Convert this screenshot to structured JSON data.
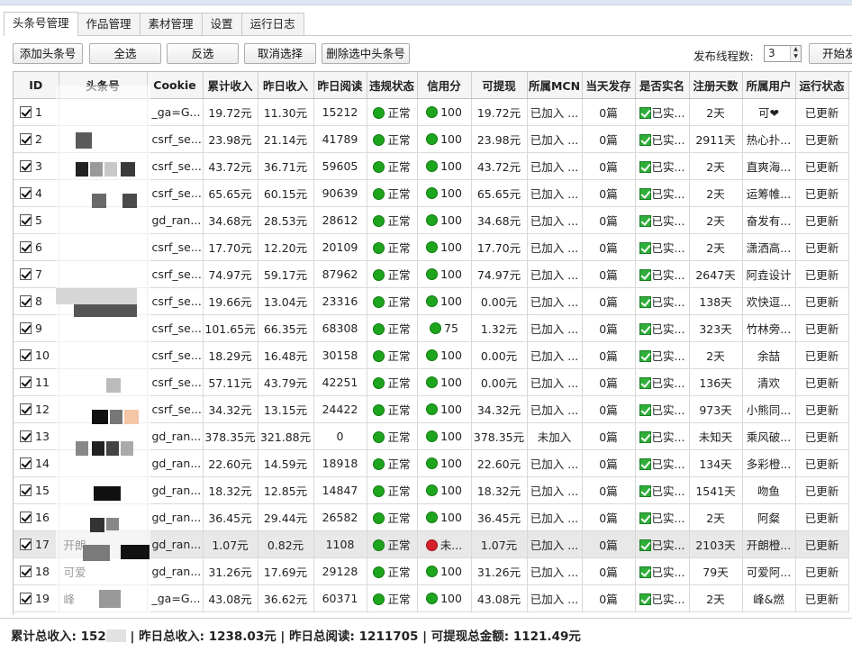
{
  "tabs": [
    {
      "label": "头条号管理",
      "active": true
    },
    {
      "label": "作品管理",
      "active": false
    },
    {
      "label": "素材管理",
      "active": false
    },
    {
      "label": "设置",
      "active": false
    },
    {
      "label": "运行日志",
      "active": false
    }
  ],
  "toolbar": {
    "add_label": "添加头条号",
    "select_all_label": "全选",
    "invert_label": "反选",
    "deselect_label": "取消选择",
    "delete_selected_label": "删除选中头条号",
    "threads_label": "发布线程数:",
    "threads_value": "3",
    "start_label": "开始发"
  },
  "columns": [
    "ID",
    "头条号",
    "Cookie",
    "累计收入",
    "昨日收入",
    "昨日阅读",
    "违规状态",
    "信用分",
    "可提现",
    "所属MCN",
    "当天发存",
    "是否实名",
    "注册天数",
    "所属用户",
    "运行状态"
  ],
  "rows": [
    {
      "id": "1",
      "name": "",
      "cookie": "_ga=G...",
      "total": "19.72元",
      "yesterday": "11.30元",
      "reads": "15212",
      "violation": "正常",
      "credit": "100",
      "credit_color": "green",
      "withdraw": "19.72元",
      "mcn": "已加入 ...",
      "today": "0篇",
      "realname": "已实...",
      "days": "2天",
      "user": "可❤",
      "state": "已更新"
    },
    {
      "id": "2",
      "name": "",
      "cookie": "csrf_se...",
      "total": "23.98元",
      "yesterday": "21.14元",
      "reads": "41789",
      "violation": "正常",
      "credit": "100",
      "credit_color": "green",
      "withdraw": "23.98元",
      "mcn": "已加入 ...",
      "today": "0篇",
      "realname": "已实...",
      "days": "2911天",
      "user": "热心扑...",
      "state": "已更新"
    },
    {
      "id": "3",
      "name": "",
      "cookie": "csrf_se...",
      "total": "43.72元",
      "yesterday": "36.71元",
      "reads": "59605",
      "violation": "正常",
      "credit": "100",
      "credit_color": "green",
      "withdraw": "43.72元",
      "mcn": "已加入 ...",
      "today": "0篇",
      "realname": "已实...",
      "days": "2天",
      "user": "直爽海...",
      "state": "已更新"
    },
    {
      "id": "4",
      "name": "",
      "cookie": "csrf_se...",
      "total": "65.65元",
      "yesterday": "60.15元",
      "reads": "90639",
      "violation": "正常",
      "credit": "100",
      "credit_color": "green",
      "withdraw": "65.65元",
      "mcn": "已加入 ...",
      "today": "0篇",
      "realname": "已实...",
      "days": "2天",
      "user": "运筹帷...",
      "state": "已更新"
    },
    {
      "id": "5",
      "name": "",
      "cookie": "gd_ran...",
      "total": "34.68元",
      "yesterday": "28.53元",
      "reads": "28612",
      "violation": "正常",
      "credit": "100",
      "credit_color": "green",
      "withdraw": "34.68元",
      "mcn": "已加入 ...",
      "today": "0篇",
      "realname": "已实...",
      "days": "2天",
      "user": "奋发有...",
      "state": "已更新"
    },
    {
      "id": "6",
      "name": "",
      "cookie": "csrf_se...",
      "total": "17.70元",
      "yesterday": "12.20元",
      "reads": "20109",
      "violation": "正常",
      "credit": "100",
      "credit_color": "green",
      "withdraw": "17.70元",
      "mcn": "已加入 ...",
      "today": "0篇",
      "realname": "已实...",
      "days": "2天",
      "user": "潇洒高...",
      "state": "已更新"
    },
    {
      "id": "7",
      "name": "",
      "cookie": "csrf_se...",
      "total": "74.97元",
      "yesterday": "59.17元",
      "reads": "87962",
      "violation": "正常",
      "credit": "100",
      "credit_color": "green",
      "withdraw": "74.97元",
      "mcn": "已加入 ...",
      "today": "0篇",
      "realname": "已实...",
      "days": "2647天",
      "user": "阿垚设计",
      "state": "已更新"
    },
    {
      "id": "8",
      "name": "",
      "cookie": "csrf_se...",
      "total": "19.66元",
      "yesterday": "13.04元",
      "reads": "23316",
      "violation": "正常",
      "credit": "100",
      "credit_color": "green",
      "withdraw": "0.00元",
      "mcn": "已加入 ...",
      "today": "0篇",
      "realname": "已实...",
      "days": "138天",
      "user": "欢快逗...",
      "state": "已更新"
    },
    {
      "id": "9",
      "name": "",
      "cookie": "csrf_se...",
      "total": "101.65元",
      "yesterday": "66.35元",
      "reads": "68308",
      "violation": "正常",
      "credit": "75",
      "credit_color": "green",
      "withdraw": "1.32元",
      "mcn": "已加入 ...",
      "today": "0篇",
      "realname": "已实...",
      "days": "323天",
      "user": "竹林旁...",
      "state": "已更新"
    },
    {
      "id": "10",
      "name": "",
      "cookie": "csrf_se...",
      "total": "18.29元",
      "yesterday": "16.48元",
      "reads": "30158",
      "violation": "正常",
      "credit": "100",
      "credit_color": "green",
      "withdraw": "0.00元",
      "mcn": "已加入 ...",
      "today": "0篇",
      "realname": "已实...",
      "days": "2天",
      "user": "余喆",
      "state": "已更新"
    },
    {
      "id": "11",
      "name": "",
      "cookie": "csrf_se...",
      "total": "57.11元",
      "yesterday": "43.79元",
      "reads": "42251",
      "violation": "正常",
      "credit": "100",
      "credit_color": "green",
      "withdraw": "0.00元",
      "mcn": "已加入 ...",
      "today": "0篇",
      "realname": "已实...",
      "days": "136天",
      "user": "清欢",
      "state": "已更新"
    },
    {
      "id": "12",
      "name": "",
      "cookie": "csrf_se...",
      "total": "34.32元",
      "yesterday": "13.15元",
      "reads": "24422",
      "violation": "正常",
      "credit": "100",
      "credit_color": "green",
      "withdraw": "34.32元",
      "mcn": "已加入 ...",
      "today": "0篇",
      "realname": "已实...",
      "days": "973天",
      "user": "小熊同...",
      "state": "已更新"
    },
    {
      "id": "13",
      "name": "",
      "cookie": "gd_ran...",
      "total": "378.35元",
      "yesterday": "321.88元",
      "reads": "0",
      "violation": "正常",
      "credit": "100",
      "credit_color": "green",
      "withdraw": "378.35元",
      "mcn": "未加入",
      "today": "0篇",
      "realname": "已实...",
      "days": "未知天",
      "user": "乘风破...",
      "state": "已更新"
    },
    {
      "id": "14",
      "name": "",
      "cookie": "gd_ran...",
      "total": "22.60元",
      "yesterday": "14.59元",
      "reads": "18918",
      "violation": "正常",
      "credit": "100",
      "credit_color": "green",
      "withdraw": "22.60元",
      "mcn": "已加入 ...",
      "today": "0篇",
      "realname": "已实...",
      "days": "134天",
      "user": "多彩橙...",
      "state": "已更新"
    },
    {
      "id": "15",
      "name": "",
      "cookie": "gd_ran...",
      "total": "18.32元",
      "yesterday": "12.85元",
      "reads": "14847",
      "violation": "正常",
      "credit": "100",
      "credit_color": "green",
      "withdraw": "18.32元",
      "mcn": "已加入 ...",
      "today": "0篇",
      "realname": "已实...",
      "days": "1541天",
      "user": "吻鱼",
      "state": "已更新"
    },
    {
      "id": "16",
      "name": "",
      "cookie": "gd_ran...",
      "total": "36.45元",
      "yesterday": "29.44元",
      "reads": "26582",
      "violation": "正常",
      "credit": "100",
      "credit_color": "green",
      "withdraw": "36.45元",
      "mcn": "已加入 ...",
      "today": "0篇",
      "realname": "已实...",
      "days": "2天",
      "user": "阿粲",
      "state": "已更新"
    },
    {
      "id": "17",
      "name": "开朗",
      "cookie": "gd_ran...",
      "total": "1.07元",
      "yesterday": "0.82元",
      "reads": "1108",
      "violation": "正常",
      "credit": "未...",
      "credit_color": "red",
      "withdraw": "1.07元",
      "mcn": "已加入 ...",
      "today": "0篇",
      "realname": "已实...",
      "days": "2103天",
      "user": "开朗橙...",
      "state": "已更新",
      "selected": true
    },
    {
      "id": "18",
      "name": "可爱",
      "cookie": "gd_ran...",
      "total": "31.26元",
      "yesterday": "17.69元",
      "reads": "29128",
      "violation": "正常",
      "credit": "100",
      "credit_color": "green",
      "withdraw": "31.26元",
      "mcn": "已加入 ...",
      "today": "0篇",
      "realname": "已实...",
      "days": "79天",
      "user": "可爱阿...",
      "state": "已更新"
    },
    {
      "id": "19",
      "name": "峰",
      "cookie": "_ga=G...",
      "total": "43.08元",
      "yesterday": "36.62元",
      "reads": "60371",
      "violation": "正常",
      "credit": "100",
      "credit_color": "green",
      "withdraw": "43.08元",
      "mcn": "已加入 ...",
      "today": "0篇",
      "realname": "已实...",
      "days": "2天",
      "user": "峰&燃",
      "state": "已更新"
    }
  ],
  "status": {
    "total_income_label": "累计总收入: 152",
    "sep1": " | ",
    "yesterday_income": "昨日总收入: 1238.03元",
    "sep2": " | ",
    "yesterday_reads": "昨日总阅读: 1211705",
    "sep3": " | ",
    "withdrawable": "可提现总金额: 1121.49元"
  },
  "colors": {
    "green": "#1ea51e",
    "red": "#d6202b",
    "selected_row": "#e8e8e8"
  }
}
